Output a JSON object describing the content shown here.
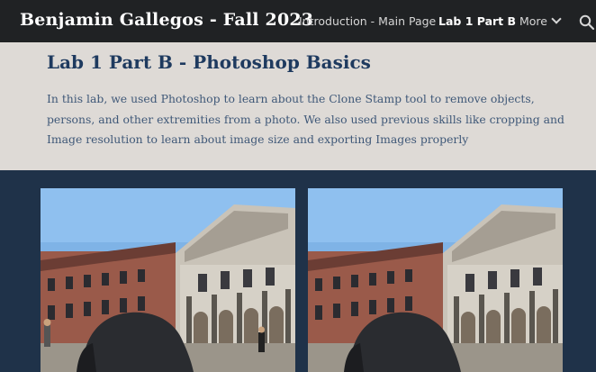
{
  "header": {
    "site_title": "Benjamin Gallegos - Fall 2023",
    "nav": [
      {
        "label": "Introduction - Main Page",
        "active": false
      },
      {
        "label": "Lab 1 Part B",
        "active": true
      },
      {
        "label": "More",
        "active": false
      }
    ],
    "search_icon": "search-icon"
  },
  "hero": {
    "title": "Lab 1 Part B - Photoshop Basics",
    "description": "In this lab, we used Photoshop to learn about the Clone Stamp tool to remove objects, persons, and other extremities from a photo. We also used previous skills like cropping and Image resolution to learn about image size and exporting Images properly"
  },
  "gallery": {
    "images": [
      {
        "name": "photo-original"
      },
      {
        "name": "photo-edited"
      }
    ]
  },
  "colors": {
    "topbar": "#202224",
    "hero_bg": "#dedad6",
    "body_bg": "#1f3249",
    "title": "#1e3a5f"
  }
}
